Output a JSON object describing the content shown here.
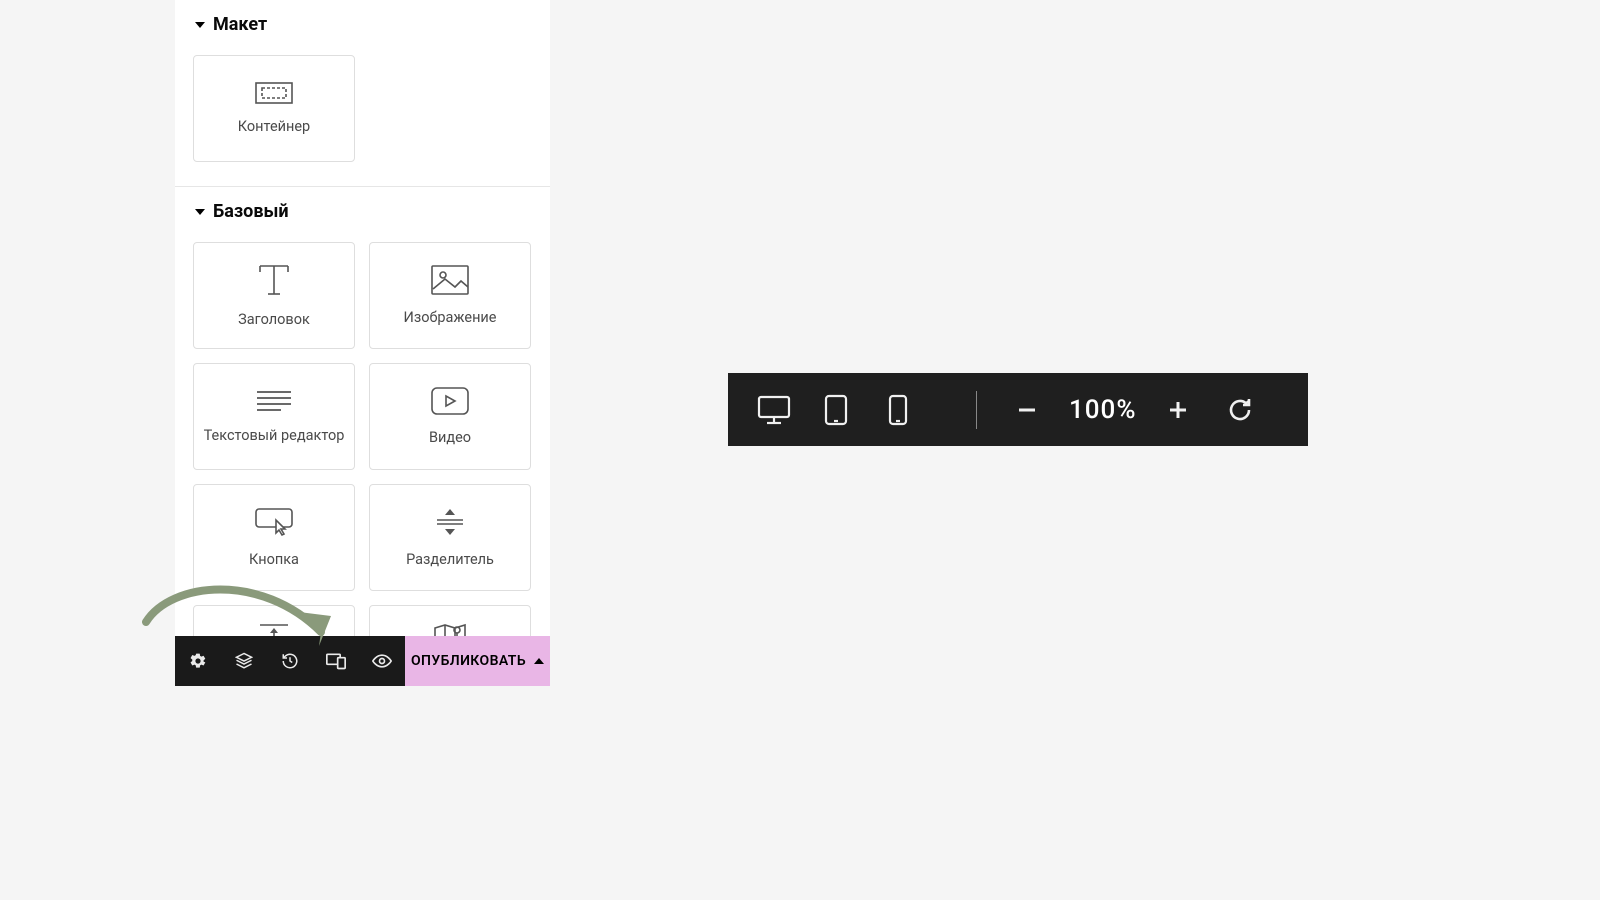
{
  "panel": {
    "sections": {
      "layout": {
        "title": "Макет",
        "widgets": [
          "Контейнер"
        ]
      },
      "basic": {
        "title": "Базовый",
        "widgets": [
          "Заголовок",
          "Изображение",
          "Текстовый редактор",
          "Видео",
          "Кнопка",
          "Разделитель"
        ]
      }
    }
  },
  "footer": {
    "publish_label": "ОПУБЛИКОВАТЬ"
  },
  "responsive_toolbar": {
    "zoom": "100%"
  }
}
